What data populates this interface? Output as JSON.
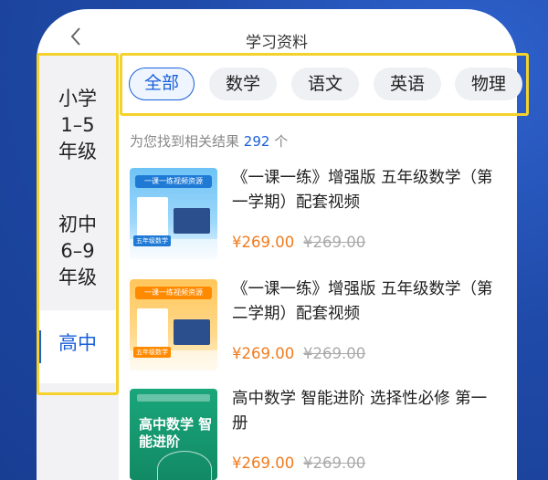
{
  "header": {
    "title": "学习资料",
    "back_icon": "chevron-left-icon"
  },
  "sidebar": {
    "items": [
      {
        "lines": [
          "小学",
          "1–5",
          "年级"
        ],
        "active": false
      },
      {
        "lines": [
          "初中",
          "6–9",
          "年级"
        ],
        "active": false
      },
      {
        "lines": [
          "高中"
        ],
        "active": true
      }
    ]
  },
  "tabs": [
    {
      "label": "全部",
      "active": true
    },
    {
      "label": "数学",
      "active": false
    },
    {
      "label": "语文",
      "active": false
    },
    {
      "label": "英语",
      "active": false
    },
    {
      "label": "物理",
      "active": false
    }
  ],
  "results": {
    "prefix": "为您找到相关结果",
    "count": "292",
    "suffix": "个"
  },
  "products": [
    {
      "title": "《一课一练》增强版 五年级数学（第一学期）配套视频",
      "price": "¥269.00",
      "original_price": "¥269.00",
      "thumb_style": "blue",
      "thumb_label": "一课一练视频资源",
      "thumb_tag": "五年级数学"
    },
    {
      "title": "《一课一练》增强版 五年级数学（第二学期）配套视频",
      "price": "¥269.00",
      "original_price": "¥269.00",
      "thumb_style": "orange",
      "thumb_label": "一课一练视频资源",
      "thumb_tag": "五年级数学"
    },
    {
      "title": "高中数学 智能进阶 选择性必修 第一册",
      "price": "¥269.00",
      "original_price": "¥269.00",
      "thumb_style": "green",
      "thumb_label": "高中数学 智能进阶"
    }
  ],
  "colors": {
    "accent": "#1a5fd8",
    "price": "#f07b1d",
    "highlight": "#f5d22b",
    "background": "#1f4aa8"
  }
}
